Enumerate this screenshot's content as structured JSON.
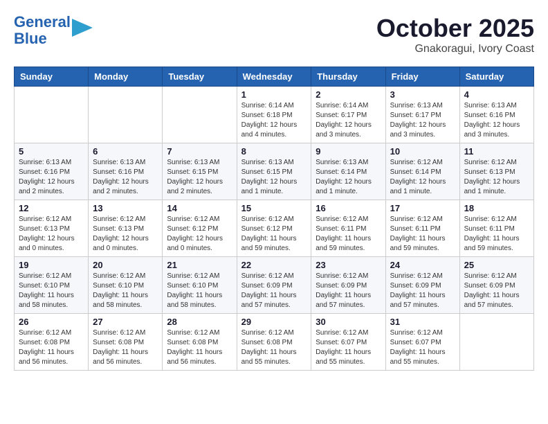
{
  "logo": {
    "line1": "General",
    "line2": "Blue"
  },
  "title": "October 2025",
  "subtitle": "Gnakoragui, Ivory Coast",
  "weekdays": [
    "Sunday",
    "Monday",
    "Tuesday",
    "Wednesday",
    "Thursday",
    "Friday",
    "Saturday"
  ],
  "weeks": [
    [
      {
        "day": "",
        "info": ""
      },
      {
        "day": "",
        "info": ""
      },
      {
        "day": "",
        "info": ""
      },
      {
        "day": "1",
        "info": "Sunrise: 6:14 AM\nSunset: 6:18 PM\nDaylight: 12 hours\nand 4 minutes."
      },
      {
        "day": "2",
        "info": "Sunrise: 6:14 AM\nSunset: 6:17 PM\nDaylight: 12 hours\nand 3 minutes."
      },
      {
        "day": "3",
        "info": "Sunrise: 6:13 AM\nSunset: 6:17 PM\nDaylight: 12 hours\nand 3 minutes."
      },
      {
        "day": "4",
        "info": "Sunrise: 6:13 AM\nSunset: 6:16 PM\nDaylight: 12 hours\nand 3 minutes."
      }
    ],
    [
      {
        "day": "5",
        "info": "Sunrise: 6:13 AM\nSunset: 6:16 PM\nDaylight: 12 hours\nand 2 minutes."
      },
      {
        "day": "6",
        "info": "Sunrise: 6:13 AM\nSunset: 6:16 PM\nDaylight: 12 hours\nand 2 minutes."
      },
      {
        "day": "7",
        "info": "Sunrise: 6:13 AM\nSunset: 6:15 PM\nDaylight: 12 hours\nand 2 minutes."
      },
      {
        "day": "8",
        "info": "Sunrise: 6:13 AM\nSunset: 6:15 PM\nDaylight: 12 hours\nand 1 minute."
      },
      {
        "day": "9",
        "info": "Sunrise: 6:13 AM\nSunset: 6:14 PM\nDaylight: 12 hours\nand 1 minute."
      },
      {
        "day": "10",
        "info": "Sunrise: 6:12 AM\nSunset: 6:14 PM\nDaylight: 12 hours\nand 1 minute."
      },
      {
        "day": "11",
        "info": "Sunrise: 6:12 AM\nSunset: 6:13 PM\nDaylight: 12 hours\nand 1 minute."
      }
    ],
    [
      {
        "day": "12",
        "info": "Sunrise: 6:12 AM\nSunset: 6:13 PM\nDaylight: 12 hours\nand 0 minutes."
      },
      {
        "day": "13",
        "info": "Sunrise: 6:12 AM\nSunset: 6:13 PM\nDaylight: 12 hours\nand 0 minutes."
      },
      {
        "day": "14",
        "info": "Sunrise: 6:12 AM\nSunset: 6:12 PM\nDaylight: 12 hours\nand 0 minutes."
      },
      {
        "day": "15",
        "info": "Sunrise: 6:12 AM\nSunset: 6:12 PM\nDaylight: 11 hours\nand 59 minutes."
      },
      {
        "day": "16",
        "info": "Sunrise: 6:12 AM\nSunset: 6:11 PM\nDaylight: 11 hours\nand 59 minutes."
      },
      {
        "day": "17",
        "info": "Sunrise: 6:12 AM\nSunset: 6:11 PM\nDaylight: 11 hours\nand 59 minutes."
      },
      {
        "day": "18",
        "info": "Sunrise: 6:12 AM\nSunset: 6:11 PM\nDaylight: 11 hours\nand 59 minutes."
      }
    ],
    [
      {
        "day": "19",
        "info": "Sunrise: 6:12 AM\nSunset: 6:10 PM\nDaylight: 11 hours\nand 58 minutes."
      },
      {
        "day": "20",
        "info": "Sunrise: 6:12 AM\nSunset: 6:10 PM\nDaylight: 11 hours\nand 58 minutes."
      },
      {
        "day": "21",
        "info": "Sunrise: 6:12 AM\nSunset: 6:10 PM\nDaylight: 11 hours\nand 58 minutes."
      },
      {
        "day": "22",
        "info": "Sunrise: 6:12 AM\nSunset: 6:09 PM\nDaylight: 11 hours\nand 57 minutes."
      },
      {
        "day": "23",
        "info": "Sunrise: 6:12 AM\nSunset: 6:09 PM\nDaylight: 11 hours\nand 57 minutes."
      },
      {
        "day": "24",
        "info": "Sunrise: 6:12 AM\nSunset: 6:09 PM\nDaylight: 11 hours\nand 57 minutes."
      },
      {
        "day": "25",
        "info": "Sunrise: 6:12 AM\nSunset: 6:09 PM\nDaylight: 11 hours\nand 57 minutes."
      }
    ],
    [
      {
        "day": "26",
        "info": "Sunrise: 6:12 AM\nSunset: 6:08 PM\nDaylight: 11 hours\nand 56 minutes."
      },
      {
        "day": "27",
        "info": "Sunrise: 6:12 AM\nSunset: 6:08 PM\nDaylight: 11 hours\nand 56 minutes."
      },
      {
        "day": "28",
        "info": "Sunrise: 6:12 AM\nSunset: 6:08 PM\nDaylight: 11 hours\nand 56 minutes."
      },
      {
        "day": "29",
        "info": "Sunrise: 6:12 AM\nSunset: 6:08 PM\nDaylight: 11 hours\nand 55 minutes."
      },
      {
        "day": "30",
        "info": "Sunrise: 6:12 AM\nSunset: 6:07 PM\nDaylight: 11 hours\nand 55 minutes."
      },
      {
        "day": "31",
        "info": "Sunrise: 6:12 AM\nSunset: 6:07 PM\nDaylight: 11 hours\nand 55 minutes."
      },
      {
        "day": "",
        "info": ""
      }
    ]
  ]
}
